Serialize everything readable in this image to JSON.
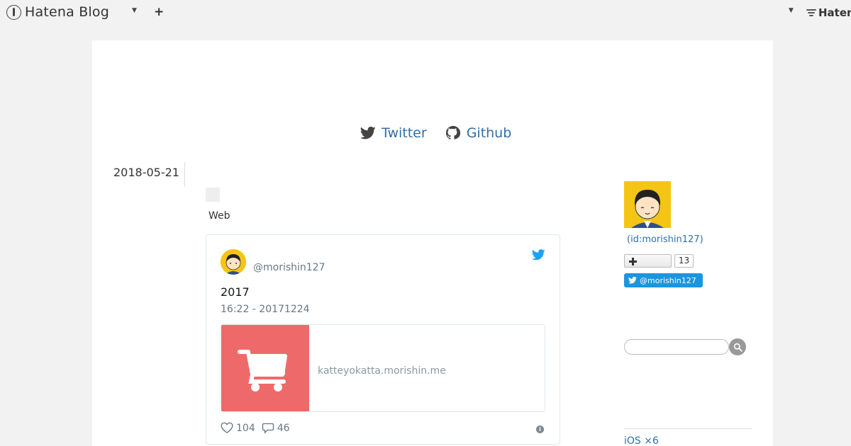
{
  "navbar": {
    "brand": "Hatena Blog",
    "right_brand": "Haten"
  },
  "header": {
    "social_links": [
      {
        "label": "Twitter",
        "icon": "twitter-icon"
      },
      {
        "label": "Github",
        "icon": "github-icon"
      }
    ]
  },
  "entry": {
    "date": "2018-05-21",
    "category": "Web"
  },
  "tweet": {
    "handle": "@morishin127",
    "text": "2017",
    "timestamp": "16:22 - 20171224",
    "link_domain": "katteyokatta.morishin.me",
    "likes": "104",
    "replies": "46"
  },
  "sidebar": {
    "user_id": "(id:morishin127)",
    "follow_count": "13",
    "twitter_follow_label": "@morishin127",
    "search_placeholder": "",
    "category_item": "iOS ×6"
  },
  "colors": {
    "link": "#2f6fa8",
    "twitter_blue": "#1da1f2",
    "link_card_image": "#ee6a6a",
    "avatar_bg": "#f4c514"
  }
}
